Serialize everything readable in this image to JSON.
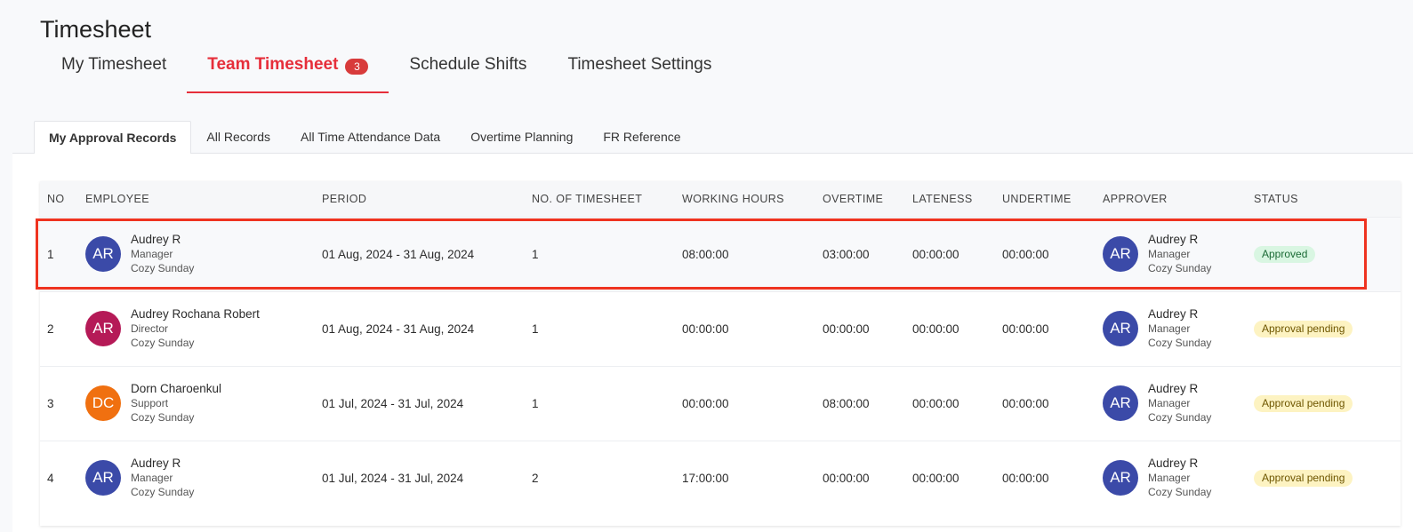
{
  "page": {
    "title": "Timesheet"
  },
  "main_tabs": [
    {
      "label": "My Timesheet",
      "active": false,
      "badge": null
    },
    {
      "label": "Team Timesheet",
      "active": true,
      "badge": "3"
    },
    {
      "label": "Schedule Shifts",
      "active": false,
      "badge": null
    },
    {
      "label": "Timesheet Settings",
      "active": false,
      "badge": null
    }
  ],
  "sub_tabs": [
    {
      "label": "My Approval Records",
      "active": true
    },
    {
      "label": "All Records",
      "active": false
    },
    {
      "label": "All Time Attendance Data",
      "active": false
    },
    {
      "label": "Overtime Planning",
      "active": false
    },
    {
      "label": "FR Reference",
      "active": false
    }
  ],
  "table": {
    "columns": [
      "NO",
      "EMPLOYEE",
      "PERIOD",
      "NO. OF TIMESHEET",
      "WORKING HOURS",
      "OVERTIME",
      "LATENESS",
      "UNDERTIME",
      "APPROVER",
      "STATUS"
    ],
    "rows": [
      {
        "no": "1",
        "employee": {
          "initials": "AR",
          "name": "Audrey R",
          "role": "Manager",
          "company": "Cozy Sunday",
          "color": "#3b4aa8"
        },
        "period": "01 Aug, 2024 - 31 Aug, 2024",
        "timesheets": "1",
        "working_hours": "08:00:00",
        "overtime": "03:00:00",
        "lateness": "00:00:00",
        "undertime": "00:00:00",
        "approver": {
          "initials": "AR",
          "name": "Audrey R",
          "role": "Manager",
          "company": "Cozy Sunday",
          "color": "#3b4aa8"
        },
        "status": "Approved",
        "status_type": "approved"
      },
      {
        "no": "2",
        "employee": {
          "initials": "AR",
          "name": "Audrey Rochana Robert",
          "role": "Director",
          "company": "Cozy Sunday",
          "color": "#b51a57"
        },
        "period": "01 Aug, 2024 - 31 Aug, 2024",
        "timesheets": "1",
        "working_hours": "00:00:00",
        "overtime": "00:00:00",
        "lateness": "00:00:00",
        "undertime": "00:00:00",
        "approver": {
          "initials": "AR",
          "name": "Audrey R",
          "role": "Manager",
          "company": "Cozy Sunday",
          "color": "#3b4aa8"
        },
        "status": "Approval pending",
        "status_type": "pending"
      },
      {
        "no": "3",
        "employee": {
          "initials": "DC",
          "name": "Dorn Charoenkul",
          "role": "Support",
          "company": "Cozy Sunday",
          "color": "#f07010"
        },
        "period": "01 Jul, 2024 - 31 Jul, 2024",
        "timesheets": "1",
        "working_hours": "00:00:00",
        "overtime": "08:00:00",
        "lateness": "00:00:00",
        "undertime": "00:00:00",
        "approver": {
          "initials": "AR",
          "name": "Audrey R",
          "role": "Manager",
          "company": "Cozy Sunday",
          "color": "#3b4aa8"
        },
        "status": "Approval pending",
        "status_type": "pending"
      },
      {
        "no": "4",
        "employee": {
          "initials": "AR",
          "name": "Audrey R",
          "role": "Manager",
          "company": "Cozy Sunday",
          "color": "#3b4aa8"
        },
        "period": "01 Jul, 2024 - 31 Jul, 2024",
        "timesheets": "2",
        "working_hours": "17:00:00",
        "overtime": "00:00:00",
        "lateness": "00:00:00",
        "undertime": "00:00:00",
        "approver": {
          "initials": "AR",
          "name": "Audrey R",
          "role": "Manager",
          "company": "Cozy Sunday",
          "color": "#3b4aa8"
        },
        "status": "Approval pending",
        "status_type": "pending"
      }
    ]
  },
  "colors": {
    "accent": "#e62e3a",
    "highlight_border": "#ef3320"
  }
}
